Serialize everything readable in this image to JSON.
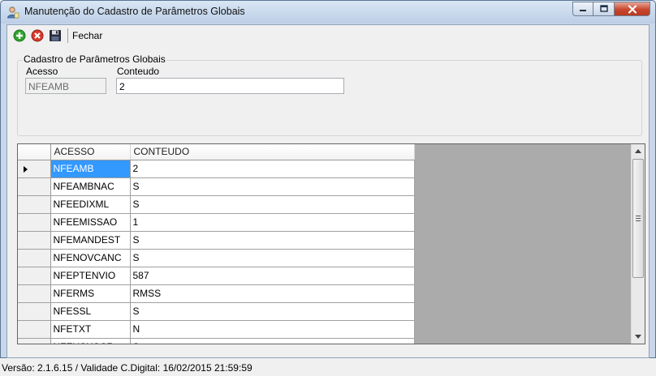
{
  "window": {
    "title": "Manutenção do Cadastro de Parâmetros Globais"
  },
  "toolbar": {
    "add_icon": "add-green-circle-icon",
    "cancel_icon": "cancel-red-circle-icon",
    "save_icon": "floppy-disk-icon",
    "close_label": "Fechar"
  },
  "form": {
    "group_title": "Cadastro de Parâmetros Globais",
    "acesso_label": "Acesso",
    "acesso_value": "NFEAMB",
    "conteudo_label": "Conteudo",
    "conteudo_value": "2"
  },
  "grid": {
    "columns": [
      "ACESSO",
      "CONTEUDO"
    ],
    "rows": [
      [
        "NFEAMB",
        "2"
      ],
      [
        "NFEAMBNAC",
        "S"
      ],
      [
        "NFEEDIXML",
        "S"
      ],
      [
        "NFEEMISSAO",
        "1"
      ],
      [
        "NFEMANDEST",
        "S"
      ],
      [
        "NFENOVCANC",
        "S"
      ],
      [
        "NFEPTENVIO",
        "587"
      ],
      [
        "NFERMS",
        "RMSS"
      ],
      [
        "NFESSL",
        "S"
      ],
      [
        "NFETXT",
        "N"
      ],
      [
        "NFEUSUSCR",
        "S"
      ]
    ],
    "selected_row": 0
  },
  "status": {
    "text": "Versão: 2.1.6.15 / Validade C.Digital: 16/02/2015 21:59:59"
  },
  "colors": {
    "selection": "#3399ff",
    "add_green": "#2fa52f",
    "cancel_red": "#d93a2b"
  }
}
